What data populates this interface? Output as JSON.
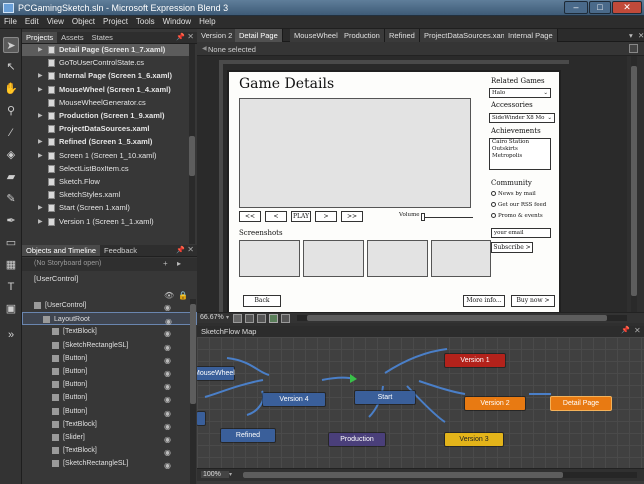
{
  "window": {
    "title": "PCGamingSketch.sln - Microsoft Expression Blend 3",
    "minimize": "–",
    "maximize": "□",
    "close": "✕"
  },
  "menu": [
    "File",
    "Edit",
    "View",
    "Object",
    "Project",
    "Tools",
    "Window",
    "Help"
  ],
  "toolbar": {
    "icons": [
      "arrow-select-icon",
      "direct-select-icon",
      "pan-icon",
      "zoom-icon",
      "eyedropper-icon",
      "paint-bucket-icon",
      "brush-gradient-icon",
      "pencil-icon",
      "pen-icon",
      "rectangle-icon",
      "grid-layout-icon",
      "textblock-icon",
      "control-icon",
      "asset-expander-icon"
    ]
  },
  "left_panel": {
    "tabs": [
      "Projects",
      "Assets",
      "States"
    ],
    "projects": [
      {
        "label": "Detail Page (Screen 1_7.xaml)",
        "bold": true,
        "selected": true,
        "expand": "▶"
      },
      {
        "label": "GoToUserControlState.cs",
        "bold": false,
        "selected": false,
        "expand": ""
      },
      {
        "label": "Internal Page (Screen 1_6.xaml)",
        "bold": true,
        "selected": false,
        "expand": "▶"
      },
      {
        "label": "MouseWheel (Screen 1_4.xaml)",
        "bold": true,
        "selected": false,
        "expand": "▶"
      },
      {
        "label": "MouseWheelGenerator.cs",
        "bold": false,
        "selected": false,
        "expand": ""
      },
      {
        "label": "Production (Screen 1_9.xaml)",
        "bold": true,
        "selected": false,
        "expand": "▶"
      },
      {
        "label": "ProjectDataSources.xaml",
        "bold": true,
        "selected": false,
        "expand": ""
      },
      {
        "label": "Refined (Screen 1_5.xaml)",
        "bold": true,
        "selected": false,
        "expand": "▶"
      },
      {
        "label": "Screen 1 (Screen 1_10.xaml)",
        "bold": false,
        "selected": false,
        "expand": "▶"
      },
      {
        "label": "SelectListBoxItem.cs",
        "bold": false,
        "selected": false,
        "expand": ""
      },
      {
        "label": "Sketch.Flow",
        "bold": false,
        "selected": false,
        "expand": ""
      },
      {
        "label": "SketchStyles.xaml",
        "bold": false,
        "selected": false,
        "expand": ""
      },
      {
        "label": "Start (Screen 1.xaml)",
        "bold": false,
        "selected": false,
        "expand": "▶"
      },
      {
        "label": "Version 1 (Screen 1_1.xaml)",
        "bold": false,
        "selected": false,
        "expand": "▶"
      }
    ],
    "objects_tabs": [
      "Objects and Timeline",
      "Feedback"
    ],
    "storyboard": "(No Storyboard open)",
    "user_control_scope": "[UserControl]",
    "tree": [
      {
        "label": "[UserControl]",
        "indent": 12,
        "selected": false
      },
      {
        "label": "LayoutRoot",
        "indent": 20,
        "selected": true
      },
      {
        "label": "[TextBlock]",
        "indent": 30,
        "selected": false
      },
      {
        "label": "[SketchRectangleSL]",
        "indent": 30,
        "selected": false
      },
      {
        "label": "[Button]",
        "indent": 30,
        "selected": false
      },
      {
        "label": "[Button]",
        "indent": 30,
        "selected": false
      },
      {
        "label": "[Button]",
        "indent": 30,
        "selected": false
      },
      {
        "label": "[Button]",
        "indent": 30,
        "selected": false
      },
      {
        "label": "[Button]",
        "indent": 30,
        "selected": false
      },
      {
        "label": "[TextBlock]",
        "indent": 30,
        "selected": false
      },
      {
        "label": "[Slider]",
        "indent": 30,
        "selected": false
      },
      {
        "label": "[TextBlock]",
        "indent": 30,
        "selected": false
      },
      {
        "label": "[SketchRectangleSL]",
        "indent": 30,
        "selected": false
      }
    ]
  },
  "doc_tabs": [
    "Version 2",
    "Detail Page",
    "MouseWheel",
    "Production",
    "Refined",
    "ProjectDataSources.xaml",
    "Internal Page"
  ],
  "active_doc_tab": "Detail Page",
  "selection_status": "None selected",
  "mockup": {
    "title": "Game Details",
    "player_buttons": [
      "<<",
      "<",
      "PLAY",
      ">",
      ">>"
    ],
    "volume_label": "Volume",
    "screenshots_label": "Screenshots",
    "back_button": "Back",
    "more_info_button": "More info...",
    "buy_button": "Buy now >",
    "related_games_label": "Related Games",
    "related_games_value": "Halo",
    "accessories_label": "Accessories",
    "accessories_value": "SideWinder X8 Mo",
    "achievements_label": "Achievements",
    "achievements": [
      "Cairo Station",
      "Outskirts",
      "Metropolis"
    ],
    "community_label": "Community",
    "community_options": [
      "News by mail",
      "Get our RSS feed",
      "Promo & events"
    ],
    "email_placeholder": "your email",
    "subscribe_button": "Subscribe >"
  },
  "zoom_value": "66.67%",
  "sketchflow_map": {
    "title": "SketchFlow Map",
    "nodes": [
      "MouseWheel",
      "Version 4",
      "Start",
      "Version 1",
      "Version 2",
      "Detail Page",
      "Refined",
      "Production",
      "Version 3"
    ],
    "zoom": "100%"
  },
  "colors": {
    "node_blue": "#3a5f9a",
    "node_red": "#b3221b",
    "node_orange": "#e87a12",
    "node_purple": "#4a3f7a",
    "node_yellow": "#e3b41a"
  }
}
